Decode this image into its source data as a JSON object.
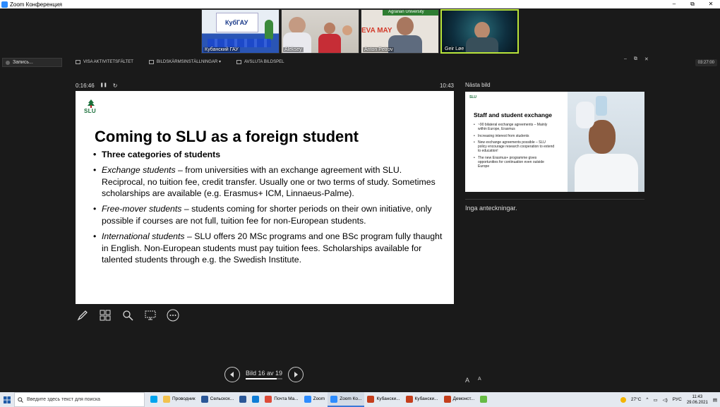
{
  "window": {
    "title": "Zoom Конференция",
    "controls": [
      "–",
      "⧉",
      "✕"
    ]
  },
  "videos": [
    {
      "name": "Кубанский ГАУ",
      "banner": "КубГАУ"
    },
    {
      "name": "Aleksey"
    },
    {
      "name": "Anton Petrov",
      "banner": "EVA MAY",
      "banner2": "Agrarian University"
    },
    {
      "name": "Geir Løe"
    }
  ],
  "recording": {
    "label": "Запись..."
  },
  "toolbar": {
    "taskbar_label": "VISA AKTIVITETSFÄLTET",
    "display_settings_label": "BILDSKÄRMSINSTÄLLNINGAR ▾",
    "end_show_label": "AVSLUTA BILDSPEL"
  },
  "top_right_time": "03:27:00",
  "presenter": {
    "elapsed": "0:16:46",
    "pause_icon": "❚❚",
    "reset_icon": "↻",
    "clock": "10:43"
  },
  "slide": {
    "logo_text": "SLU",
    "title": "Coming to SLU as a foreign student",
    "bullets": {
      "b0": "Three categories of students",
      "b1_em": "Exchange students",
      "b1_rest": " – from universities with an exchange agreement with SLU. Reciprocal, no tuition fee, credit transfer. Usually one or two terms of study. Sometimes scholarships are available (e.g. Erasmus+ ICM, Linnaeus-Palme).",
      "b2_em": "Free-mover students",
      "b2_rest": " – students coming for shorter periods on their own initiative, only possible if courses are not full, tuition fee for non-European students.",
      "b3_em": "International students",
      "b3_rest": " – SLU offers 20 MSc programs and one BSc program fully thaught in English. Non-European students must pay tuition fees. Scholarships available for talented students through e.g. the Swedish Institute."
    }
  },
  "next": {
    "label": "Nästa bild",
    "logo_text": "SLU",
    "title": "Staff and student exchange",
    "bullets": [
      "~90 bilateral exchange agreements – Mainly within Europe, Erasmus",
      "Increasing interest from students",
      "New exchange agreements possible – SLU policy encourage research cooperation to extend to education!",
      "The new Erasmus+ programme gives opportunities for continuation even outside Europe"
    ]
  },
  "notes": {
    "text": "Inga anteckningar."
  },
  "font_controls": {
    "increase": "A",
    "decrease": "A"
  },
  "nav": {
    "label": "Bild 16 av 19",
    "current": 16,
    "total": 19
  },
  "taskbar": {
    "search_placeholder": "Введите здесь текст для поиска",
    "apps": [
      {
        "label": "",
        "color": "#00a4ef"
      },
      {
        "label": "Проводник",
        "color": "#f2c14e"
      },
      {
        "label": "Сельскох...",
        "color": "#2b5797"
      },
      {
        "label": "",
        "color": "#2b5797"
      },
      {
        "label": "",
        "color": "#0f7dd6"
      },
      {
        "label": "Почта Ma...",
        "color": "#dd4b39"
      },
      {
        "label": "Zoom",
        "color": "#2d8cff"
      },
      {
        "label": "Zoom Ко...",
        "color": "#2d8cff",
        "active": true
      },
      {
        "label": "Кубански...",
        "color": "#c43e1c"
      },
      {
        "label": "Кубански...",
        "color": "#c43e1c"
      },
      {
        "label": "Демонст...",
        "color": "#c43e1c"
      },
      {
        "label": "",
        "color": "#6b4"
      }
    ],
    "weather": "27°C",
    "lang": "РУС",
    "time": "11:43",
    "date": "29.06.2021"
  }
}
